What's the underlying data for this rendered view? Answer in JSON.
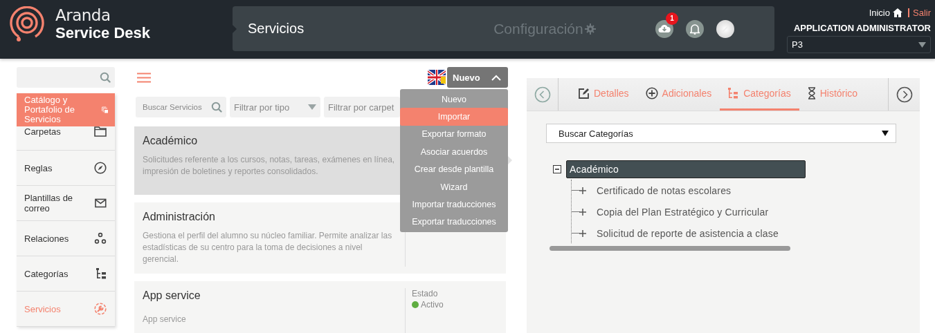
{
  "header": {
    "logo_line1": "Aranda",
    "logo_line2": "Service Desk",
    "section": "Servicios",
    "config_label": "Configuración",
    "download_badge": "1",
    "home_link": "Inicio",
    "logout_link": "Salir",
    "role": "APPLICATION ADMINISTRATOR",
    "project": "P3"
  },
  "sidebar": {
    "section": {
      "label": "Catálogo y Portafolio de Servicios",
      "selected": true
    },
    "items": [
      {
        "label": "Carpetas",
        "selected": false
      },
      {
        "label": "Reglas",
        "selected": false
      },
      {
        "label": "Plantillas de correo",
        "selected": false
      },
      {
        "label": "Relaciones",
        "selected": false
      },
      {
        "label": "Categorías",
        "selected": false
      },
      {
        "label": "Servicios",
        "selected": true
      }
    ]
  },
  "toolbar": {
    "new_button": {
      "label": "Nuevo",
      "expanded": true
    },
    "menu": [
      {
        "label": "Nuevo",
        "selected": false
      },
      {
        "label": "Importar",
        "selected": true
      },
      {
        "label": "Exportar formato",
        "selected": false
      },
      {
        "label": "Asociar acuerdos",
        "selected": false
      },
      {
        "label": "Crear desde plantilla",
        "selected": false
      },
      {
        "label": "Wizard",
        "selected": false
      },
      {
        "label": "Importar traducciones",
        "selected": false
      },
      {
        "label": "Exportar traducciones",
        "selected": false
      }
    ]
  },
  "filters": {
    "search_placeholder": "Buscar Servicios",
    "type_placeholder": "Filtrar por tipo",
    "folder_placeholder": "Filtrar por carpet"
  },
  "services": [
    {
      "title": "Académico",
      "description": "Solicitudes referente a los cursos, notas, tareas, exámenes en línea, impresión de boletines y reportes consolidados.",
      "selected": true
    },
    {
      "title": "Administración",
      "description": "Gestiona el perfil del alumno su núcleo familiar. Permite analizar las estadísticas de su centro para la toma de decisiones a nivel gerencial.",
      "selected": false
    },
    {
      "title": "App service",
      "description": "App service",
      "selected": false,
      "status_label": "Estado",
      "status_value": "Activo",
      "active": true
    }
  ],
  "detail": {
    "tabs": [
      {
        "label": "Detalles",
        "selected": false
      },
      {
        "label": "Adicionales",
        "selected": false
      },
      {
        "label": "Categorías",
        "selected": true
      },
      {
        "label": "Histórico",
        "selected": false
      }
    ],
    "category_search": "Buscar Categorías",
    "tree": [
      {
        "label": "Académico",
        "expanded": true,
        "selected": true,
        "children": [
          {
            "label": "Certificado de notas escolares",
            "expanded": false,
            "selected": false
          },
          {
            "label": "Copia del Plan Estratégico y Curricular",
            "expanded": false,
            "selected": false
          },
          {
            "label": "Solicitud de reporte de asistencia a clase",
            "expanded": false,
            "selected": false
          }
        ]
      }
    ]
  }
}
